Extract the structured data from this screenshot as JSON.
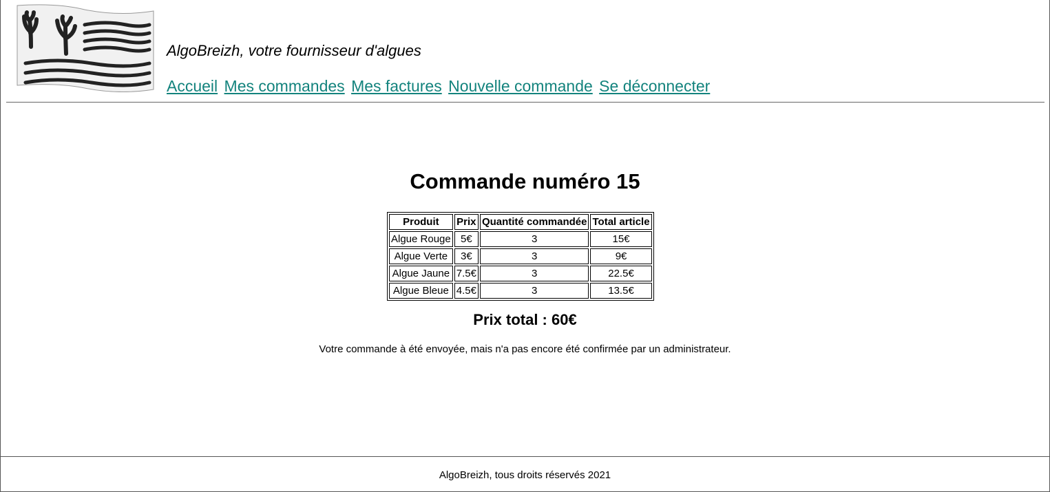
{
  "header": {
    "tagline": "AlgoBreizh, votre fournisseur d'algues",
    "nav": [
      {
        "label": "Accueil"
      },
      {
        "label": "Mes commandes"
      },
      {
        "label": "Mes factures"
      },
      {
        "label": "Nouvelle commande"
      },
      {
        "label": "Se déconnecter"
      }
    ],
    "logo_icon": "seaweed-flag-icon"
  },
  "main": {
    "title": "Commande numéro 15",
    "table": {
      "headers": [
        "Produit",
        "Prix",
        "Quantité commandée",
        "Total article"
      ],
      "rows": [
        [
          "Algue Rouge",
          "5€",
          "3",
          "15€"
        ],
        [
          "Algue Verte",
          "3€",
          "3",
          "9€"
        ],
        [
          "Algue Jaune",
          "7.5€",
          "3",
          "22.5€"
        ],
        [
          "Algue Bleue",
          "4.5€",
          "3",
          "13.5€"
        ]
      ]
    },
    "total": "Prix total : 60€",
    "notice": "Votre commande à été envoyée, mais n'a pas encore été confirmée par un administrateur."
  },
  "footer": {
    "text": "AlgoBreizh, tous droits réservés 2021"
  },
  "colors": {
    "link": "#13837d",
    "border": "#555555"
  }
}
